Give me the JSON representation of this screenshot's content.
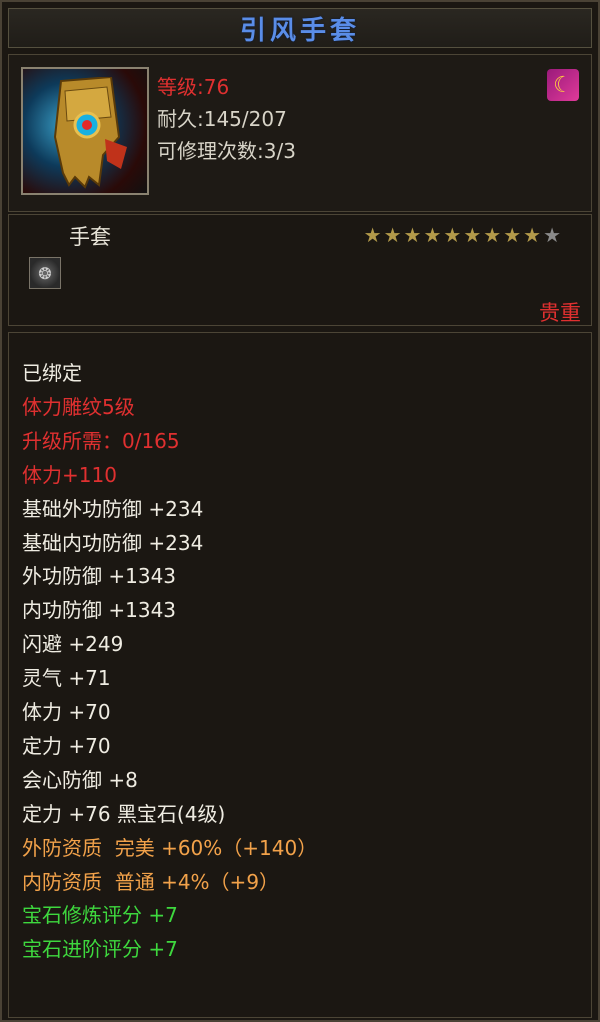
{
  "item": {
    "name": "引风手套",
    "level_text": "等级:76",
    "durability_text": "耐久:145/207",
    "repair_text": "可修理次数:3/3",
    "school_icon": "school-emblem-icon",
    "type": "手套",
    "stars_total": 10,
    "stars_filled": 9,
    "gem_slot_icon": "gem-slot-icon",
    "quality": "贵重"
  },
  "stats": [
    {
      "text": "已绑定",
      "color": "white"
    },
    {
      "text": "体力雕纹5级",
      "color": "red"
    },
    {
      "text": "升级所需：0/165",
      "color": "red"
    },
    {
      "text": "体力+110",
      "color": "red"
    },
    {
      "text": "基础外功防御 +234",
      "color": "white"
    },
    {
      "text": "基础内功防御 +234",
      "color": "white"
    },
    {
      "text": "外功防御 +1343",
      "color": "white"
    },
    {
      "text": "内功防御 +1343",
      "color": "white"
    },
    {
      "text": "闪避 +249",
      "color": "white"
    },
    {
      "text": "灵气 +71",
      "color": "white"
    },
    {
      "text": "体力 +70",
      "color": "white"
    },
    {
      "text": "定力 +70",
      "color": "white"
    },
    {
      "text": "会心防御 +8",
      "color": "white"
    },
    {
      "text": "定力 +76 黑宝石(4级)",
      "color": "white"
    },
    {
      "text": "外防资质  完美 +60%（+140）",
      "color": "orange"
    },
    {
      "text": "内防资质  普通 +4%（+9）",
      "color": "orange"
    },
    {
      "text": "宝石修炼评分 +7",
      "color": "green"
    },
    {
      "text": "宝石进阶评分 +7",
      "color": "green"
    }
  ]
}
